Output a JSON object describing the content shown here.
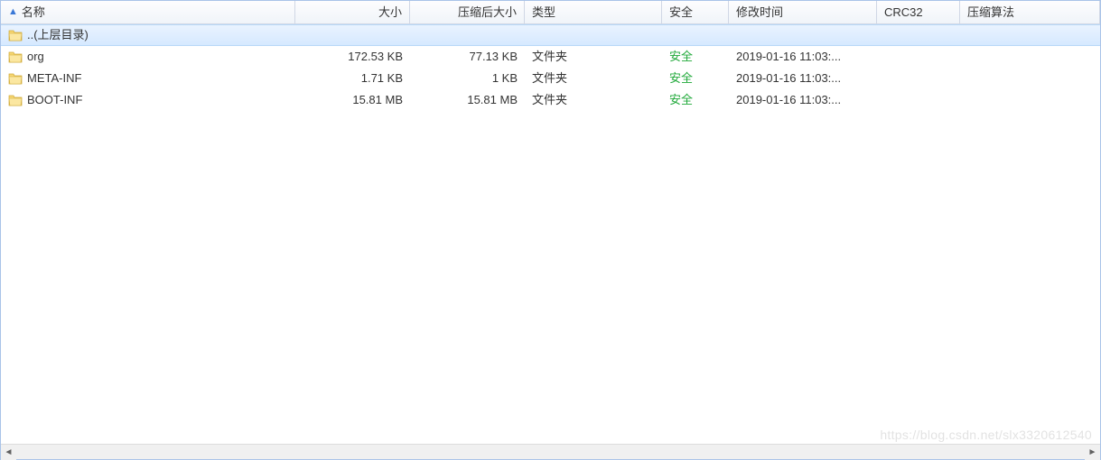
{
  "columns": {
    "name": "名称",
    "size": "大小",
    "compressed": "压缩后大小",
    "type": "类型",
    "security": "安全",
    "modified": "修改时间",
    "crc": "CRC32",
    "algorithm": "压缩算法"
  },
  "parent_dir": {
    "name": "..(上层目录)"
  },
  "rows": [
    {
      "name": "org",
      "size": "172.53 KB",
      "compressed": "77.13 KB",
      "type": "文件夹",
      "security": "安全",
      "modified": "2019-01-16 11:03:...",
      "crc": "",
      "algorithm": ""
    },
    {
      "name": "META-INF",
      "size": "1.71 KB",
      "compressed": "1 KB",
      "type": "文件夹",
      "security": "安全",
      "modified": "2019-01-16 11:03:...",
      "crc": "",
      "algorithm": ""
    },
    {
      "name": "BOOT-INF",
      "size": "15.81 MB",
      "compressed": "15.81 MB",
      "type": "文件夹",
      "security": "安全",
      "modified": "2019-01-16 11:03:...",
      "crc": "",
      "algorithm": ""
    }
  ],
  "watermark": "https://blog.csdn.net/slx3320612540"
}
